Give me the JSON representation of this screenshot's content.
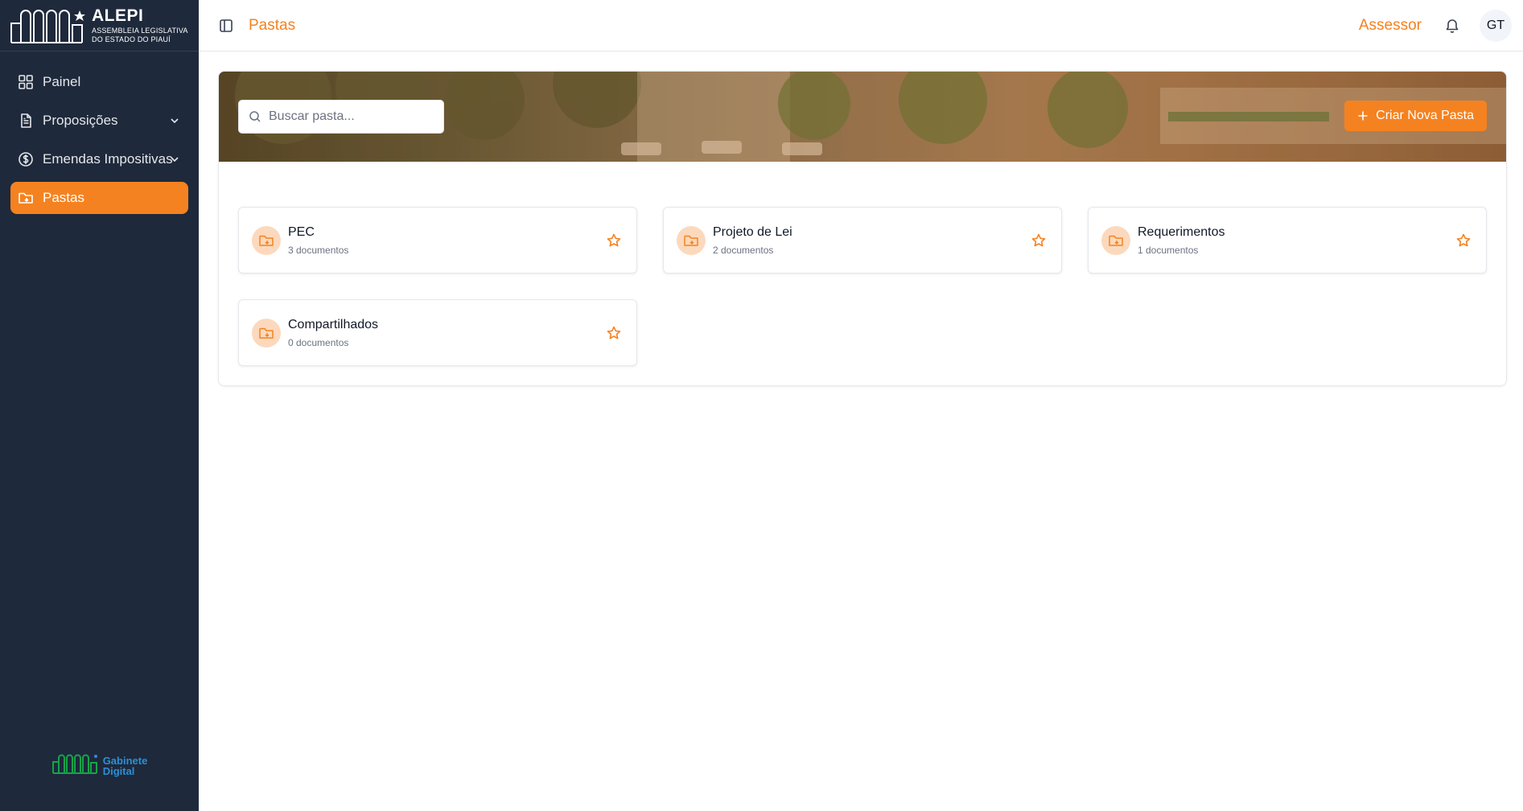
{
  "brand": {
    "title": "ALEPI",
    "subtitle_line1": "ASSEMBLEIA LEGISLATIVA",
    "subtitle_line2": "DO ESTADO DO PIAUÍ"
  },
  "sidebar": {
    "items": [
      {
        "label": "Painel",
        "icon": "grid-icon",
        "expandable": false,
        "active": false
      },
      {
        "label": "Proposições",
        "icon": "file-text-icon",
        "expandable": true,
        "active": false
      },
      {
        "label": "Emendas Impositivas",
        "icon": "dollar-circle-icon",
        "expandable": true,
        "active": false
      },
      {
        "label": "Pastas",
        "icon": "folder-icon",
        "expandable": false,
        "active": true
      }
    ],
    "footer": {
      "line1": "Gabinete",
      "line2": "Digital"
    }
  },
  "header": {
    "title": "Pastas",
    "role": "Assessor",
    "avatar_initials": "GT"
  },
  "toolbar": {
    "search_placeholder": "Buscar pasta...",
    "search_value": "",
    "create_label": "Criar Nova Pasta"
  },
  "folders": [
    {
      "name": "PEC",
      "count": "3 documentos"
    },
    {
      "name": "Projeto de Lei",
      "count": "2 documentos"
    },
    {
      "name": "Requerimentos",
      "count": "1 documentos"
    },
    {
      "name": "Compartilhados",
      "count": "0 documentos"
    }
  ],
  "colors": {
    "accent": "#f58220",
    "sidebar_bg": "#1e293b",
    "folder_badge": "#fcd9bd"
  }
}
